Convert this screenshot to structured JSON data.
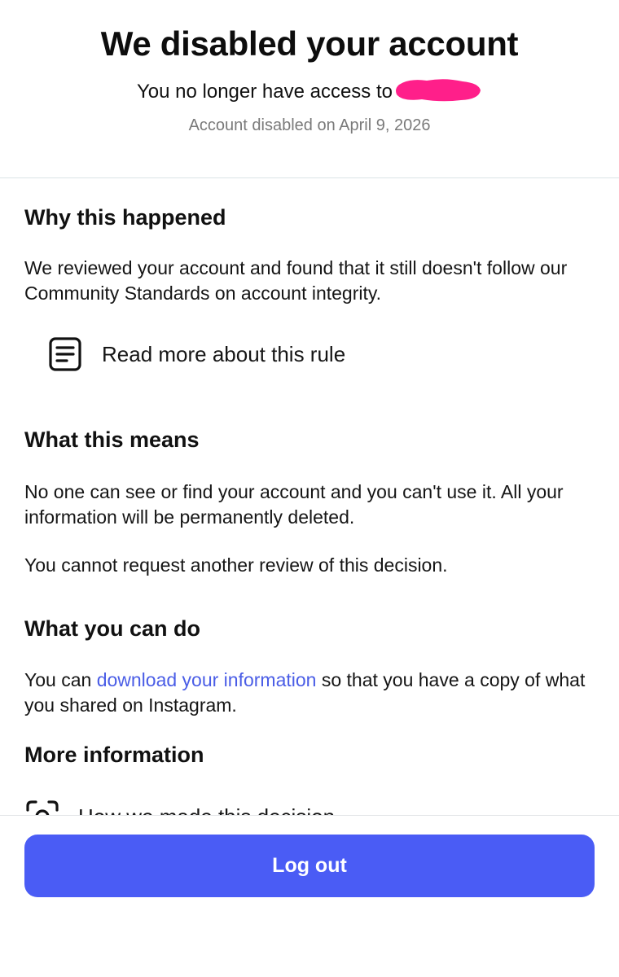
{
  "header": {
    "title": "We disabled your account",
    "subtitle_prefix": "You no longer have access to",
    "disabled_date": "Account disabled on April 9, 2026",
    "redaction_color": "#ff1f8a"
  },
  "why": {
    "title": "Why this happened",
    "body": "We reviewed your account and found that it still doesn't follow our Community Standards on account integrity.",
    "rule_link": "Read more about this rule",
    "rule_icon": "document-lines-icon"
  },
  "means": {
    "title": "What this means",
    "body1": "No one can see or find your account and you can't use it. All your information will be permanently deleted.",
    "body2": "You cannot request another review of this decision."
  },
  "can_do": {
    "title": "What you can do",
    "prefix": "You can",
    "link": "download your information",
    "suffix": "so that you have a copy of what you shared on Instagram."
  },
  "more_info": {
    "title": "More information",
    "item_label": "How we made this decision",
    "item_icon": "scan-icon"
  },
  "footer": {
    "logout_label": "Log out"
  },
  "colors": {
    "accent": "#4a5cf5",
    "link": "#4a5de6",
    "muted": "#7a7a7a"
  }
}
